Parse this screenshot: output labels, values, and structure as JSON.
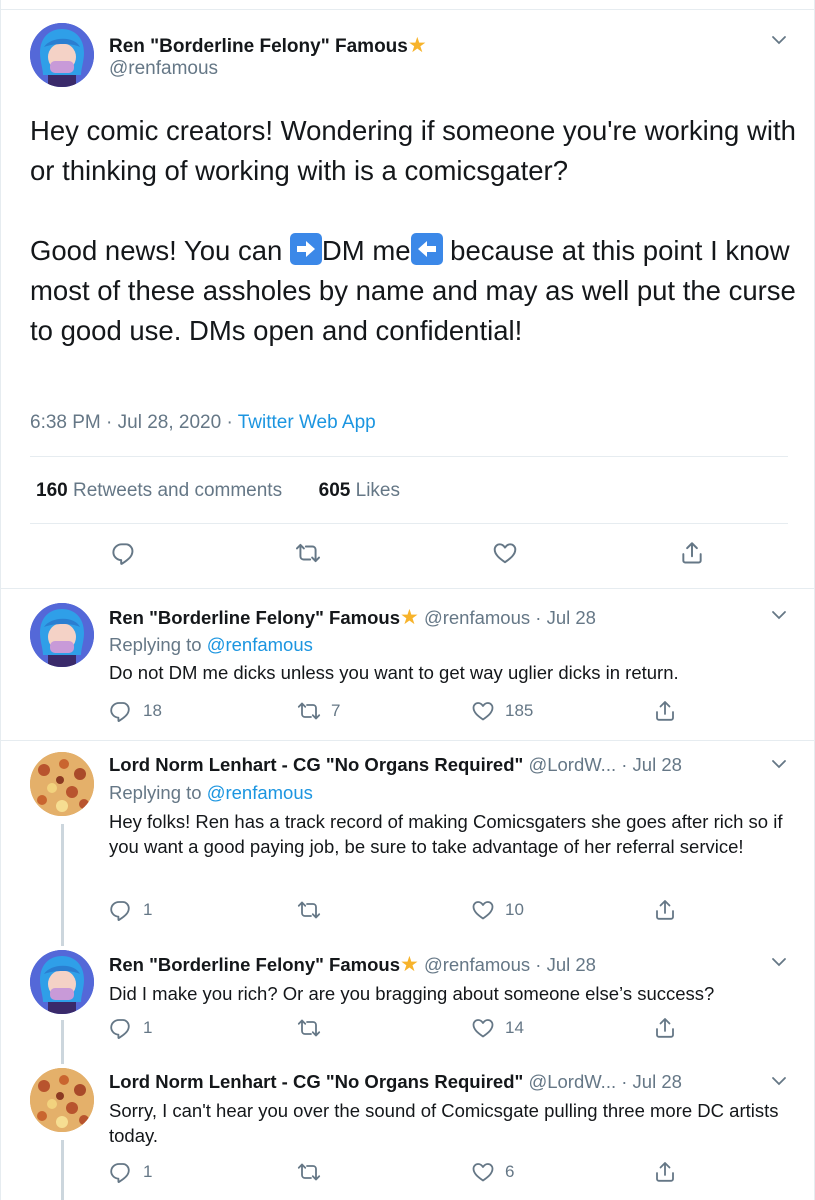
{
  "main_tweet": {
    "display_name": "Ren \"Borderline Felony\" Famous",
    "handle": "@renfamous",
    "text_p1": "Hey comic creators! Wondering if someone you're working with or thinking of working with is a comicsgater?",
    "text_p2_a": "Good news! You can ",
    "text_p2_b": "DM me",
    "text_p2_c": " because at this point I know most of these assholes by name and may as well put the curse to good use. DMs open and confidential!",
    "time": "6:38 PM · Jul 28, 2020 · ",
    "source": "Twitter Web App",
    "retweets_count": "160",
    "retweets_label": " Retweets and comments",
    "likes_count": "605",
    "likes_label": " Likes"
  },
  "replies": [
    {
      "display_name": "Ren \"Borderline Felony\" Famous",
      "handle_date": "@renfamous · Jul 28",
      "replying_prefix": "Replying to ",
      "replying_handle": "@renfamous",
      "text": "Do not DM me dicks unless you want to get way uglier dicks in return.",
      "replies": "18",
      "retweets": "7",
      "likes": "185"
    },
    {
      "display_name": "Lord Norm Lenhart - CG \"No Organs Required\"",
      "handle_date": "@LordW...  · Jul 28",
      "replying_prefix": "Replying to ",
      "replying_handle": "@renfamous",
      "text": "Hey folks! Ren has a track record of making Comicsgaters she goes after rich so if you want a good paying job, be sure to take advantage of her referral service!",
      "replies": "1",
      "retweets": "",
      "likes": "10"
    },
    {
      "display_name": "Ren \"Borderline Felony\" Famous",
      "handle_date": "@renfamous · Jul 28",
      "text": "Did I make you rich? Or are you bragging about someone else’s success?",
      "replies": "1",
      "retweets": "",
      "likes": "14"
    },
    {
      "display_name": "Lord Norm Lenhart - CG \"No Organs Required\"",
      "handle_date": "@LordW...  · Jul 28",
      "text": "Sorry, I can't hear you over the sound of Comicsgate pulling three more DC artists today.",
      "replies": "1",
      "retweets": "",
      "likes": "6"
    }
  ],
  "icons": {
    "reply": "reply-icon",
    "retweet": "retweet-icon",
    "like": "heart-icon",
    "share": "share-icon",
    "verified_star": "star-icon",
    "more": "chevron-down-icon"
  },
  "colors": {
    "link": "#1b95e0",
    "muted": "#657786",
    "star": "#f7b32b",
    "arrow_emoji": "#3b88e8"
  }
}
